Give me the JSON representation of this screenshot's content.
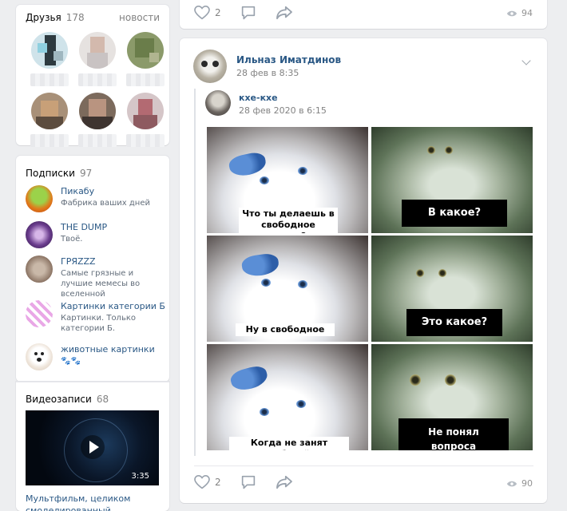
{
  "friends": {
    "title": "Друзья",
    "count": "178",
    "news_link": "новости"
  },
  "subscriptions": {
    "title": "Подписки",
    "count": "97",
    "items": [
      {
        "name": "Пикабу",
        "desc": "Фабрика ваших дней"
      },
      {
        "name": "THE DUMP",
        "desc": "Твоё."
      },
      {
        "name": "ГРЯZZZ",
        "desc": "Самые грязные и лучшие мемесы во вселенной"
      },
      {
        "name": "Картинки категории Б",
        "desc": "Картинки. Только категории Б."
      },
      {
        "name": "животные картинки",
        "desc": "🐾🐾"
      }
    ]
  },
  "videos": {
    "title": "Видеозаписи",
    "count": "68",
    "duration": "3:35",
    "video_title": "Мультфильм, целиком смоделированный компьютером"
  },
  "top_post": {
    "likes": "2",
    "views": "94"
  },
  "post": {
    "author": "Ильназ Иматдинов",
    "date": "28 фев в 8:35",
    "repost_author": "кхе-кхе",
    "repost_date": "28 фев 2020 в 6:15",
    "meme": {
      "cap1": "Что ты делаешь в свободное время?",
      "cap2": "В какое?",
      "cap3": "Ну в свободное",
      "cap4": "Это какое?",
      "cap5": "Когда не занят работой",
      "cap6": "Не понял вопроса"
    },
    "likes": "2",
    "views": "90"
  }
}
